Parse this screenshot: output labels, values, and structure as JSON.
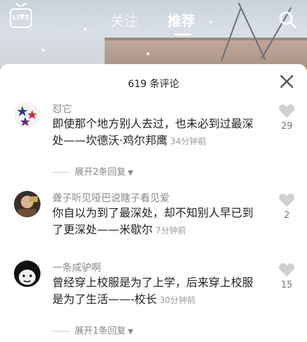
{
  "top_nav": {
    "live_label": "LIVE",
    "tabs": [
      {
        "label": "关注",
        "active": false
      },
      {
        "label": "推荐",
        "active": true
      }
    ]
  },
  "sheet": {
    "title": "619 条评论"
  },
  "comments": [
    {
      "username": "怼它",
      "text": "即使那个地方别人去过，也未必到过最深处——坎德沃·鸡尔邦鹰",
      "time": "34分钟前",
      "likes": "29",
      "replies": "展开2条回复"
    },
    {
      "username": "聋子听见哑巴说瞎子看见爱",
      "text": "你自以为到了最深处，却不知别人早已到了更深处——米歇尔",
      "time": "7分钟前",
      "likes": "2",
      "replies": ""
    },
    {
      "username": "一条咸驴啊",
      "text": "曾经穿上校服是为了上学，后来穿上校服是为了生活——-校长",
      "time": "30分钟前",
      "likes": "15",
      "replies": "展开1条回复"
    }
  ],
  "colors": {
    "accent_text": "#222222",
    "muted": "#8a8a8a",
    "heart": "#d0d0d0"
  }
}
